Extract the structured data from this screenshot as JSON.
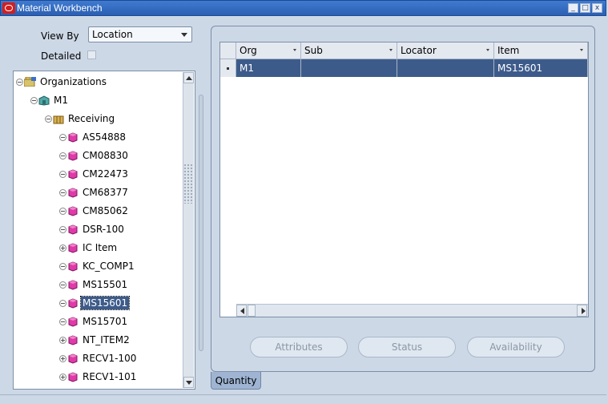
{
  "window": {
    "title": "Material Workbench",
    "buttons": [
      "minimize",
      "maximize",
      "close"
    ]
  },
  "filters": {
    "view_by_label": "View By",
    "view_by_value": "Location",
    "detailed_label": "Detailed",
    "detailed_checked": false
  },
  "tree": {
    "root": "Organizations",
    "org": "M1",
    "subinventory": "Receiving",
    "items": [
      "AS54888",
      "CM08830",
      "CM22473",
      "CM68377",
      "CM85062",
      "DSR-100",
      "IC Item",
      "KC_COMP1",
      "MS15501",
      "MS15601",
      "MS15701",
      "NT_ITEM2",
      "RECV1-100",
      "RECV1-101"
    ],
    "selected_item": "MS15601",
    "expanded_items": [
      "IC Item",
      "NT_ITEM2",
      "RECV1-100",
      "RECV1-101"
    ]
  },
  "grid": {
    "columns": [
      "Org",
      "Sub",
      "Locator",
      "Item"
    ],
    "rows": [
      {
        "org": "M1",
        "sub": "",
        "locator": "",
        "item": "MS15601"
      }
    ]
  },
  "actions": {
    "attributes": "Attributes",
    "status": "Status",
    "availability": "Availability"
  },
  "tabs": {
    "quantity": "Quantity"
  },
  "colors": {
    "titlebar": "#2b5fb3",
    "background": "#cdd8e6",
    "selection": "#3d5b8a",
    "tab": "#9eb4d2"
  }
}
